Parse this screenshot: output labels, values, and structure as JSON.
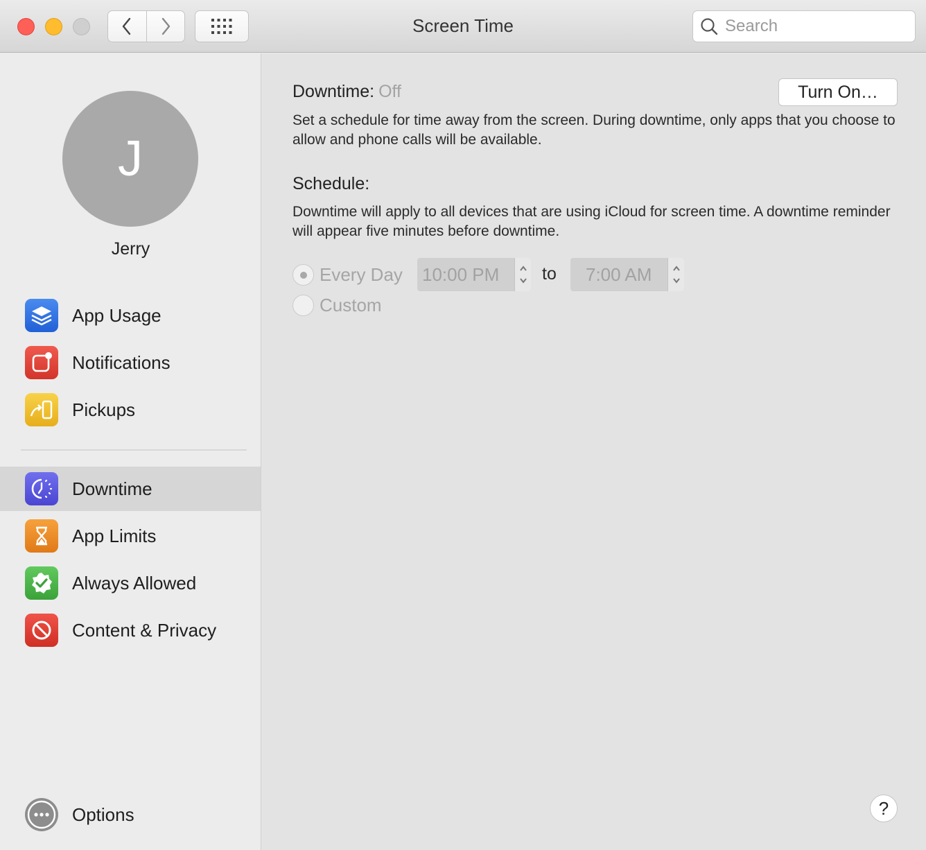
{
  "window": {
    "title": "Screen Time"
  },
  "toolbar": {
    "search_placeholder": "Search"
  },
  "user": {
    "initial": "J",
    "name": "Jerry"
  },
  "sidebar": {
    "items": [
      {
        "label": "App Usage",
        "icon": "layers-icon",
        "color": "#2f6fe0"
      },
      {
        "label": "Notifications",
        "icon": "notification-badge-icon",
        "color": "#e3453a"
      },
      {
        "label": "Pickups",
        "icon": "phone-pickup-icon",
        "color": "#f0c32e"
      },
      {
        "label": "Downtime",
        "icon": "downtime-clock-icon",
        "color": "#5b5be0",
        "selected": true
      },
      {
        "label": "App Limits",
        "icon": "hourglass-icon",
        "color": "#f08c25"
      },
      {
        "label": "Always Allowed",
        "icon": "checkmark-seal-icon",
        "color": "#4cb54a"
      },
      {
        "label": "Content & Privacy",
        "icon": "prohibited-icon",
        "color": "#e03d33"
      }
    ],
    "options": {
      "label": "Options",
      "icon": "ellipsis-circle-icon"
    }
  },
  "main": {
    "downtime_label": "Downtime:",
    "downtime_status": "Off",
    "turn_on_button": "Turn On…",
    "downtime_description": "Set a schedule for time away from the screen. During downtime, only apps that you choose to allow and phone calls will be available.",
    "schedule_label": "Schedule:",
    "schedule_description": "Downtime will apply to all devices that are using iCloud for screen time. A downtime reminder will appear five minutes before downtime.",
    "every_day_label": "Every Day",
    "start_time": "10:00 PM",
    "to_label": "to",
    "end_time": "7:00 AM",
    "custom_label": "Custom",
    "help_label": "?"
  }
}
